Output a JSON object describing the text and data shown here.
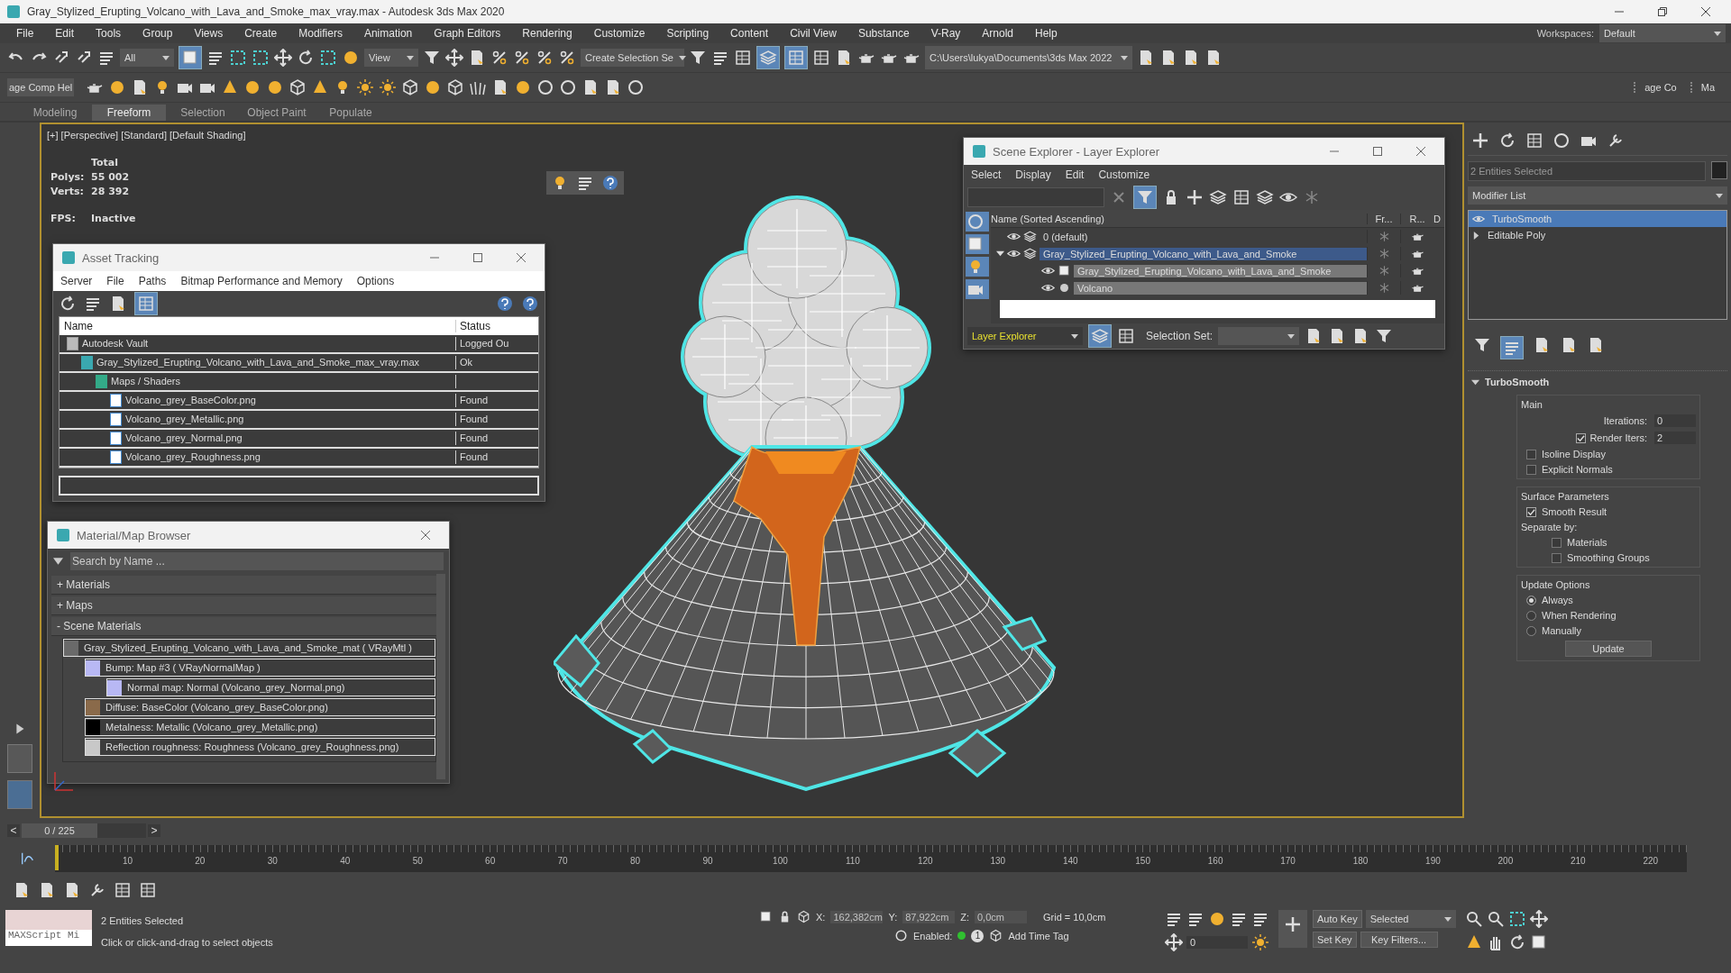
{
  "window": {
    "title": "Gray_Stylized_Erupting_Volcano_with_Lava_and_Smoke_max_vray.max - Autodesk 3ds Max 2020"
  },
  "menu": [
    "File",
    "Edit",
    "Tools",
    "Group",
    "Views",
    "Create",
    "Modifiers",
    "Animation",
    "Graph Editors",
    "Rendering",
    "Customize",
    "Scripting",
    "Content",
    "Civil View",
    "Substance",
    "V-Ray",
    "Arnold",
    "Help"
  ],
  "workspaces": {
    "label": "Workspaces:",
    "value": "Default"
  },
  "main_toolbar": {
    "selection_filter": "All",
    "reference_coordinate": "View",
    "named_selection": "Create Selection Se",
    "project_path": "C:\\Users\\lukya\\Documents\\3ds Max 2022"
  },
  "secondary_toolbar": {
    "left_label": "age Comp Hel",
    "right_labels": [
      "age Co",
      "Ma"
    ]
  },
  "ribbon_tabs": [
    {
      "label": "Modeling",
      "selected": false
    },
    {
      "label": "Freeform",
      "selected": true
    },
    {
      "label": "Selection",
      "selected": false
    },
    {
      "label": "Object Paint",
      "selected": false
    },
    {
      "label": "Populate",
      "selected": false
    }
  ],
  "viewport": {
    "label": "[+] [Perspective] [Standard] [Default Shading]",
    "stats": {
      "heading": "Total",
      "rows": [
        {
          "label": "Polys:",
          "value": "55 002"
        },
        {
          "label": "Verts:",
          "value": "28 392"
        }
      ],
      "fps_label": "FPS:",
      "fps_value": "Inactive"
    }
  },
  "asset_tracking": {
    "title": "Asset Tracking",
    "menu": [
      "Server",
      "File",
      "Paths",
      "Bitmap Performance and Memory",
      "Options"
    ],
    "columns": [
      "Name",
      "Status"
    ],
    "rows": [
      {
        "name": "Autodesk Vault",
        "status": "Logged Ou",
        "kind": "vault",
        "children": [
          {
            "name": "Gray_Stylized_Erupting_Volcano_with_Lava_and_Smoke_max_vray.max",
            "status": "Ok",
            "kind": "scene",
            "children": [
              {
                "name": "Maps / Shaders",
                "kind": "folder",
                "children": [
                  {
                    "name": "Volcano_grey_BaseColor.png",
                    "status": "Found",
                    "kind": "image"
                  },
                  {
                    "name": "Volcano_grey_Metallic.png",
                    "status": "Found",
                    "kind": "image"
                  },
                  {
                    "name": "Volcano_grey_Normal.png",
                    "status": "Found",
                    "kind": "image"
                  },
                  {
                    "name": "Volcano_grey_Roughness.png",
                    "status": "Found",
                    "kind": "image"
                  }
                ]
              }
            ]
          }
        ]
      }
    ]
  },
  "material_browser": {
    "title": "Material/Map Browser",
    "search": {
      "placeholder": "Search by Name ..."
    },
    "groups": [
      {
        "sign": "+",
        "label": "Materials"
      },
      {
        "sign": "+",
        "label": "Maps"
      },
      {
        "sign": "-",
        "label": "Scene Materials"
      }
    ],
    "tree": [
      {
        "label": "Gray_Stylized_Erupting_Volcano_with_Lava_and_Smoke_mat ( VRayMtl )",
        "color": "#6a6a6a",
        "children": [
          {
            "label": "Bump: Map #3 ( VRayNormalMap )",
            "color": "#b8b8f4",
            "children": [
              {
                "label": "Normal map: Normal (Volcano_grey_Normal.png)",
                "color": "#b8b8f4"
              }
            ]
          },
          {
            "label": "Diffuse: BaseColor (Volcano_grey_BaseColor.png)",
            "color": "#8a6a4a"
          },
          {
            "label": "Metalness: Metallic (Volcano_grey_Metallic.png)",
            "color": "#000000"
          },
          {
            "label": "Reflection roughness: Roughness (Volcano_grey_Roughness.png)",
            "color": "#c8c8c8"
          }
        ]
      }
    ]
  },
  "scene_explorer": {
    "title": "Scene Explorer - Layer Explorer",
    "menu": [
      "Select",
      "Display",
      "Edit",
      "Customize"
    ],
    "columns": [
      "Name (Sorted Ascending)",
      "Fr...",
      "R...",
      "D"
    ],
    "tree": [
      {
        "name": "0 (default)",
        "kind": "layer",
        "selected": false
      },
      {
        "name": "Gray_Stylized_Erupting_Volcano_with_Lava_and_Smoke",
        "kind": "layer",
        "selected": true,
        "expanded": true,
        "children": [
          {
            "name": "Gray_Stylized_Erupting_Volcano_with_Lava_and_Smoke",
            "kind": "group",
            "selected": true
          },
          {
            "name": "Volcano",
            "kind": "object",
            "selected": true
          }
        ]
      }
    ],
    "explorer_mode": "Layer Explorer",
    "selection_set_label": "Selection Set:"
  },
  "command_panel": {
    "name_field": {
      "placeholder": "2 Entities Selected"
    },
    "modifier_list": "Modifier List",
    "stack": [
      {
        "label": "TurboSmooth",
        "selected": true,
        "expandable": false
      },
      {
        "label": "Editable Poly",
        "selected": false,
        "expandable": true
      }
    ],
    "rollout": {
      "title": "TurboSmooth",
      "main_title": "Main",
      "iterations": {
        "label": "Iterations:",
        "value": "0"
      },
      "render_iters": {
        "label": "Render Iters:",
        "checked": true,
        "value": "2"
      },
      "options": [
        {
          "label": "Isoline Display",
          "checked": false
        },
        {
          "label": "Explicit Normals",
          "checked": false
        }
      ],
      "surface_title": "Surface Parameters",
      "smooth_result": {
        "label": "Smooth Result",
        "checked": true
      },
      "separate_label": "Separate by:",
      "separate": [
        {
          "label": "Materials",
          "checked": false
        },
        {
          "label": "Smoothing Groups",
          "checked": false
        }
      ],
      "update_title": "Update Options",
      "update_options": [
        {
          "label": "Always",
          "selected": true
        },
        {
          "label": "When Rendering",
          "selected": false
        },
        {
          "label": "Manually",
          "selected": false
        }
      ],
      "update_button": "Update"
    }
  },
  "timeline": {
    "prev": "<",
    "next": ">",
    "frame_label": "0 / 225",
    "level": 0,
    "ticks": [
      "10",
      "20",
      "30",
      "40",
      "50",
      "60",
      "70",
      "80",
      "90",
      "100",
      "110",
      "120",
      "130",
      "140",
      "150",
      "160",
      "170",
      "180",
      "190",
      "200",
      "210",
      "220"
    ]
  },
  "status": {
    "maxscript": "MAXScript Mi",
    "selection": "2 Entities Selected",
    "prompt": "Click or click-and-drag to select objects",
    "coords": [
      {
        "label": "X:",
        "value": "162,382cm"
      },
      {
        "label": "Y:",
        "value": "87,922cm"
      },
      {
        "label": "Z:",
        "value": "0,0cm"
      }
    ],
    "grid": "Grid = 10,0cm",
    "enabled_label": "Enabled:",
    "enabled": true,
    "time_tag_count": "1",
    "add_time_tag": "Add Time Tag",
    "auto_key": "Auto Key",
    "key_mode": "Selected",
    "set_key": "Set Key",
    "key_filters": "Key Filters...",
    "frame": "0"
  }
}
